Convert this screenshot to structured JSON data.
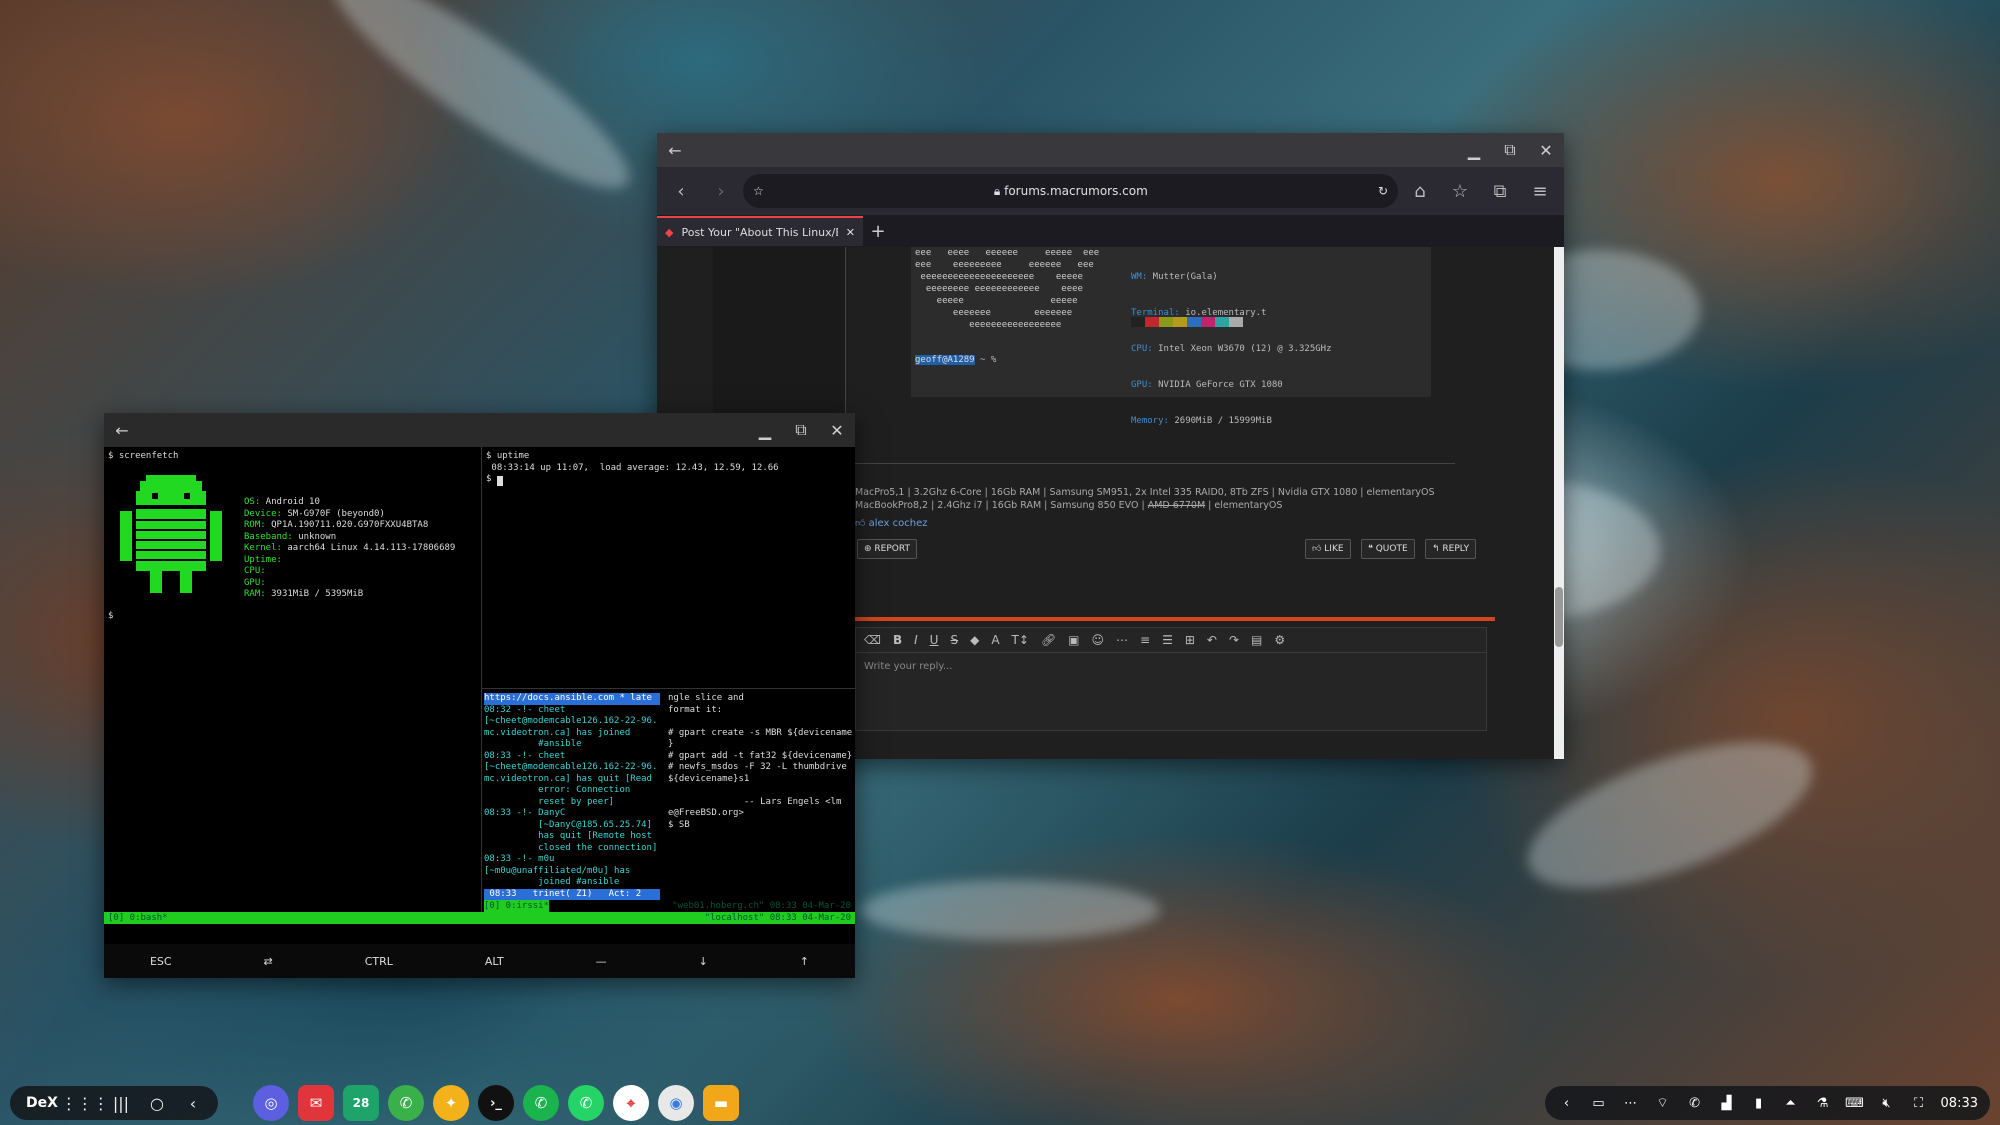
{
  "browser": {
    "url": "forums.macrumors.com",
    "tab_title": "Post Your \"About This Linux/B...",
    "neofetch": {
      "art": "eee   eeee   eeeeee     eeeee  eee\neee    eeeeeeeee     eeeeee   eee\n eeeeeeeeeeeeeeeeeeeee    eeeee\n  eeeeeeee eeeeeeeeeeee    eeee\n    eeeee                eeeee\n       eeeeeee        eeeeeee\n          eeeeeeeeeeeeeeeee",
      "info_lines": [
        {
          "k": "WM:",
          "v": " Mutter(Gala)"
        },
        {
          "k": "Terminal:",
          "v": " io.elementary.t"
        },
        {
          "k": "CPU:",
          "v": " Intel Xeon W3670 (12) @ 3.325GHz"
        },
        {
          "k": "GPU:",
          "v": " NVIDIA GeForce GTX 1080"
        },
        {
          "k": "Memory:",
          "v": " 2690MiB / 15999MiB"
        }
      ],
      "prompt_user": "geoff@A1289",
      "prompt_rest": " ~ %"
    },
    "signature_1": "MacPro5,1 | 3.2Ghz 6-Core | 16Gb RAM | Samsung SM951, 2x Intel 335 RAID0, 8Tb ZFS | Nvidia GTX 1080 | elementaryOS",
    "signature_2a": "MacBookPro8,2 | 2.4Ghz i7 | 16Gb RAM | Samsung 850 EVO | ",
    "signature_2b": "AMD 6770M",
    "signature_2c": " | elementaryOS",
    "reaction_user": "alex cochez",
    "report_label": "REPORT",
    "like_label": "LIKE",
    "quote_label": "QUOTE",
    "reply_label": "REPLY",
    "reply_placeholder": "Write your reply..."
  },
  "terminal": {
    "left_pane": {
      "cmd": "$ screenfetch",
      "info": [
        {
          "k": "OS:",
          "v": " Android 10"
        },
        {
          "k": "Device:",
          "v": " SM-G970F (beyond0)"
        },
        {
          "k": "ROM:",
          "v": " QP1A.190711.020.G970FXXU4BTA8"
        },
        {
          "k": "Baseband:",
          "v": " unknown"
        },
        {
          "k": "Kernel:",
          "v": " aarch64 Linux 4.14.113-17806689"
        },
        {
          "k": "Uptime:",
          "v": ""
        },
        {
          "k": "CPU:",
          "v": ""
        },
        {
          "k": "GPU:",
          "v": ""
        },
        {
          "k": "RAM:",
          "v": " 3931MiB / 5395MiB"
        }
      ],
      "prompt": "$"
    },
    "right_top": "$ uptime\n 08:33:14 up 11:07,  load average: 12.43, 12.59, 12.66\n$ ",
    "irc_header": "https://docs.ansible.com * late",
    "irc_lines": "08:32 -!- cheet\n[~cheet@modemcable126.162-22-96.\nmc.videotron.ca] has joined\n          #ansible\n08:33 -!- cheet\n[~cheet@modemcable126.162-22-96.\nmc.videotron.ca] has quit [Read\n          error: Connection\n          reset by peer]\n08:33 -!- DanyC\n          [~DanyC@185.65.25.74]\n          has quit [Remote host\n          closed the connection]\n08:33 -!- m0u\n[~m0u@unaffiliated/m0u] has\n          joined #ansible",
    "irc_status": " 08:33   trinet( Z1)   Act: 2 ",
    "irc_channel": "[#ansible]",
    "right_bottom": "ngle slice and\nformat it:\n\n# gpart create -s MBR ${devicename\n}\n# gpart add -t fat32 ${devicename}\n# newfs_msdos -F 32 -L thumbdrive\n${devicename}s1\n\n              -- Lars Engels <lm\ne@FreeBSD.org>\n$ SB",
    "status_left": "[0] 0:bash*",
    "status_mid": "[0] 0:irssi*",
    "status_right_1": "\"web01.hoberg.ch\" 08:33 04-Mar-20",
    "status_right_2": "\"localhost\" 08:33 04-Mar-20",
    "keys": [
      "ESC",
      "⇄",
      "CTRL",
      "ALT",
      "—",
      "↓",
      "↑"
    ]
  },
  "taskbar": {
    "dex_label": "DeX",
    "clock": "08:33",
    "apps": [
      {
        "name": "samsung-internet-icon",
        "color": "#5b5fe0",
        "glyph": "◎"
      },
      {
        "name": "email-icon",
        "color": "#e0353b",
        "glyph": "✉"
      },
      {
        "name": "calendar-icon",
        "color": "#1ea36a",
        "glyph": "28"
      },
      {
        "name": "phone-icon",
        "color": "#3ab04a",
        "glyph": "✆"
      },
      {
        "name": "ideas-icon",
        "color": "#f3b21a",
        "glyph": "✦"
      },
      {
        "name": "terminal-icon",
        "color": "#111111",
        "glyph": "›_"
      },
      {
        "name": "call-icon",
        "color": "#1ab34e",
        "glyph": "✆"
      },
      {
        "name": "whatsapp-icon",
        "color": "#25d366",
        "glyph": "✆"
      },
      {
        "name": "maps-icon",
        "color": "#ffffff",
        "glyph": "⌖"
      },
      {
        "name": "chrome-icon",
        "color": "#e8e8e8",
        "glyph": "◉"
      },
      {
        "name": "files-icon",
        "color": "#f2a71b",
        "glyph": "▬"
      }
    ]
  }
}
